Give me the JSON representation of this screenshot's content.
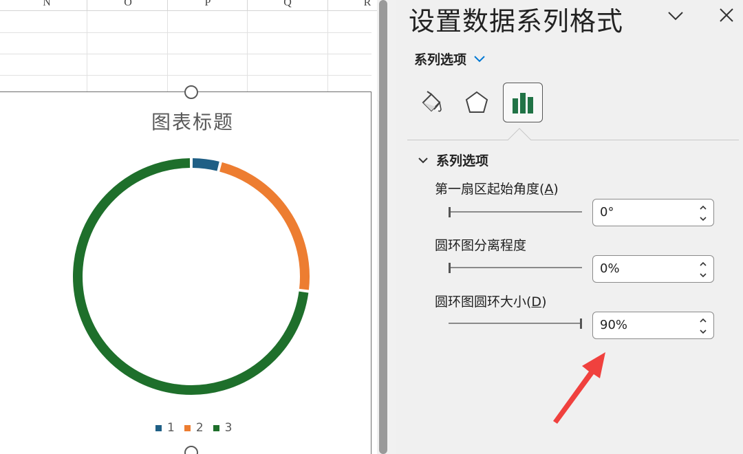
{
  "sheet": {
    "columns": [
      "N",
      "O",
      "P",
      "Q",
      "R"
    ]
  },
  "chart": {
    "title": "图表标题",
    "chart_data": {
      "type": "pie",
      "subtype": "doughnut",
      "categories": [
        "1",
        "2",
        "3"
      ],
      "values": [
        4,
        23,
        73
      ],
      "colors": [
        "#1f5f85",
        "#ed7d31",
        "#1e6f2b"
      ],
      "legend": "bottom",
      "title": "图表标题"
    }
  },
  "pane": {
    "title": "设置数据系列格式",
    "collapse_icon": "chevron-down-icon",
    "close_icon": "close-icon",
    "series_options_dropdown": "系列选项",
    "tabs": [
      {
        "name": "fill-line",
        "icon": "paint-bucket-icon"
      },
      {
        "name": "effects",
        "icon": "pentagon-icon"
      },
      {
        "name": "series-options",
        "icon": "bar-chart-icon",
        "selected": true
      }
    ],
    "section_title": "系列选项",
    "options": [
      {
        "label_main": "第一扇区起始角度(",
        "label_key": "A",
        "label_end": ")",
        "value": "0°",
        "slider_fraction": 0
      },
      {
        "label_main": "圆环图分离程度",
        "label_key": "",
        "label_end": "",
        "value": "0%",
        "slider_fraction": 0
      },
      {
        "label_main": "圆环图圆环大小(",
        "label_key": "D",
        "label_end": ")",
        "value": "90%",
        "slider_fraction": 1
      }
    ]
  },
  "accent_color": "#0078d4",
  "annotation_arrow_color": "#f0413e"
}
